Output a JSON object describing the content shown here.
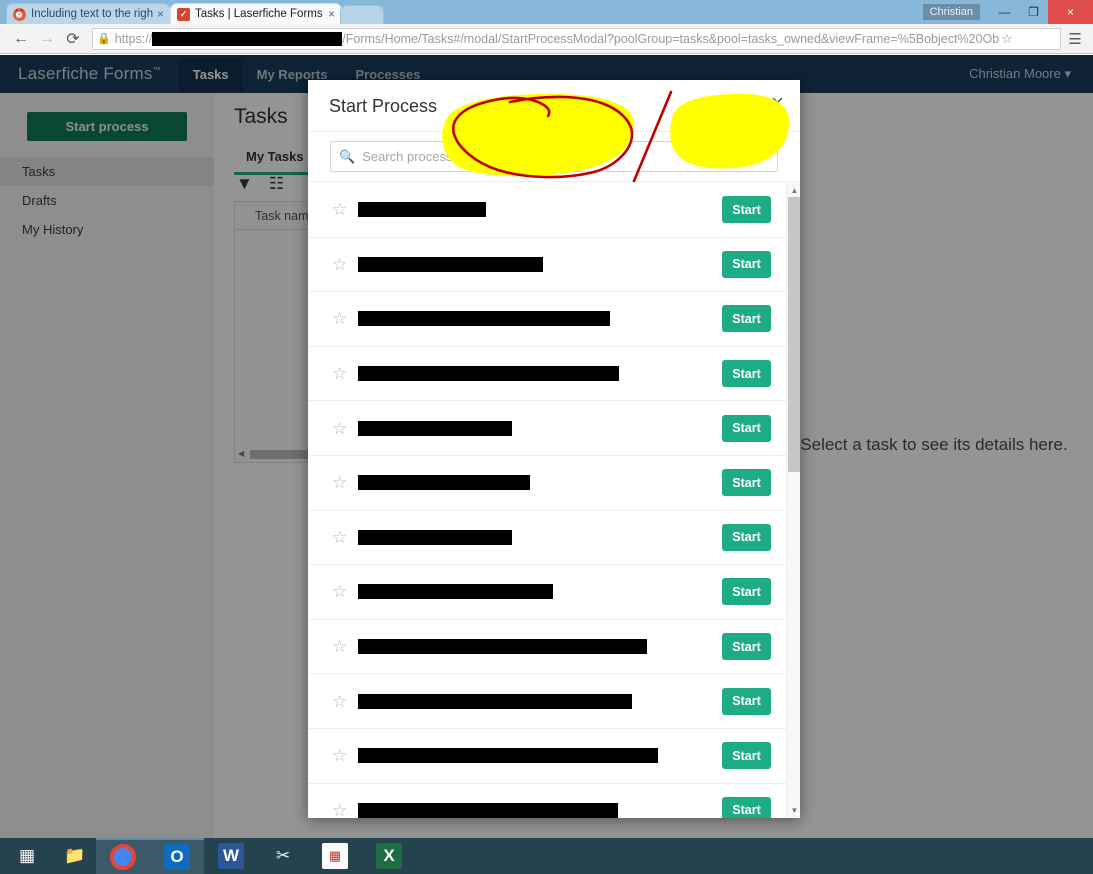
{
  "browser": {
    "tabs": [
      {
        "title": "Including text to the right",
        "favicon": "clock-icon",
        "active": false,
        "close": "×"
      },
      {
        "title": "Tasks | Laserfiche Forms",
        "favicon": "checkbox-icon",
        "active": true,
        "close": "×"
      }
    ],
    "window": {
      "user_label": "Christian",
      "minimize": "—",
      "maximize": "❐",
      "close": "×"
    },
    "toolbar": {
      "back": "←",
      "forward": "→",
      "reload": "⟳",
      "lock_icon": "lock-icon",
      "url_scheme": "https://",
      "url_rest": "/Forms/Home/Tasks#/modal/StartProcessModal?poolGroup=tasks&pool=tasks_owned&viewFrame=%5Bobject%20Ob",
      "bookmark_star": "☆",
      "menu": "☰"
    }
  },
  "app": {
    "brand": "Laserfiche Forms",
    "brand_tm": "™",
    "nav": [
      {
        "label": "Tasks",
        "active": true
      },
      {
        "label": "My Reports",
        "active": false
      },
      {
        "label": "Processes",
        "active": false
      }
    ],
    "user": "Christian Moore",
    "user_caret": "▾"
  },
  "sidebar": {
    "start_process_button": "Start process",
    "items": [
      {
        "label": "Tasks",
        "selected": true
      },
      {
        "label": "Drafts",
        "selected": false
      },
      {
        "label": "My History",
        "selected": false
      }
    ]
  },
  "main": {
    "page_title": "Tasks",
    "tabs": [
      {
        "label": "My Tasks",
        "active": true
      }
    ],
    "tools": [
      {
        "name": "filter-icon",
        "glyph": "▼"
      },
      {
        "name": "columns-icon",
        "glyph": "☷"
      }
    ],
    "table": {
      "columns": [
        "Task name"
      ]
    },
    "detail_placeholder": "Select a task to see its details here."
  },
  "modal": {
    "title": "Start Process",
    "close_label": "×",
    "search": {
      "placeholder": "Search processes",
      "value": "",
      "icon": "search-icon"
    },
    "start_button_label": "Start",
    "star_glyph": "☆",
    "scrollbar": {
      "up": "▲",
      "down": "▼"
    },
    "rows": [
      {
        "redacted_width": 128
      },
      {
        "redacted_width": 185
      },
      {
        "redacted_width": 252
      },
      {
        "redacted_width": 261
      },
      {
        "redacted_width": 154
      },
      {
        "redacted_width": 172
      },
      {
        "redacted_width": 154
      },
      {
        "redacted_width": 195
      },
      {
        "redacted_width": 289
      },
      {
        "redacted_width": 274
      },
      {
        "redacted_width": 300
      },
      {
        "redacted_width": 260
      }
    ]
  },
  "annotations": [
    {
      "type": "highlight",
      "color": "#ffff00",
      "name": "yellow-highlight-left"
    },
    {
      "type": "highlight",
      "color": "#ffff00",
      "name": "yellow-highlight-right"
    },
    {
      "type": "pen-circle",
      "color": "#c00000",
      "name": "red-circle-annotation"
    },
    {
      "type": "pen-line",
      "color": "#c00000",
      "name": "red-slash-annotation"
    }
  ],
  "taskbar": {
    "items": [
      {
        "name": "windows-start-icon",
        "label": "⊞",
        "running": false
      },
      {
        "name": "file-explorer-icon",
        "label": "🗂",
        "running": false
      },
      {
        "name": "chrome-icon",
        "label": "",
        "running": true
      },
      {
        "name": "outlook-icon",
        "label": "O",
        "running": true
      },
      {
        "name": "word-icon",
        "label": "W",
        "running": false
      },
      {
        "name": "snipping-tool-icon",
        "label": "✂",
        "running": false
      },
      {
        "name": "calculator-icon",
        "label": "∷",
        "running": false
      },
      {
        "name": "excel-icon",
        "label": "X",
        "running": false
      }
    ]
  },
  "colors": {
    "app_navy": "#1a3c5e",
    "teal_accent": "#1eac86",
    "dark_green": "#117a5c",
    "highlight_yellow": "#ffff00",
    "pen_red": "#c00000",
    "taskbar": "#25424f"
  }
}
